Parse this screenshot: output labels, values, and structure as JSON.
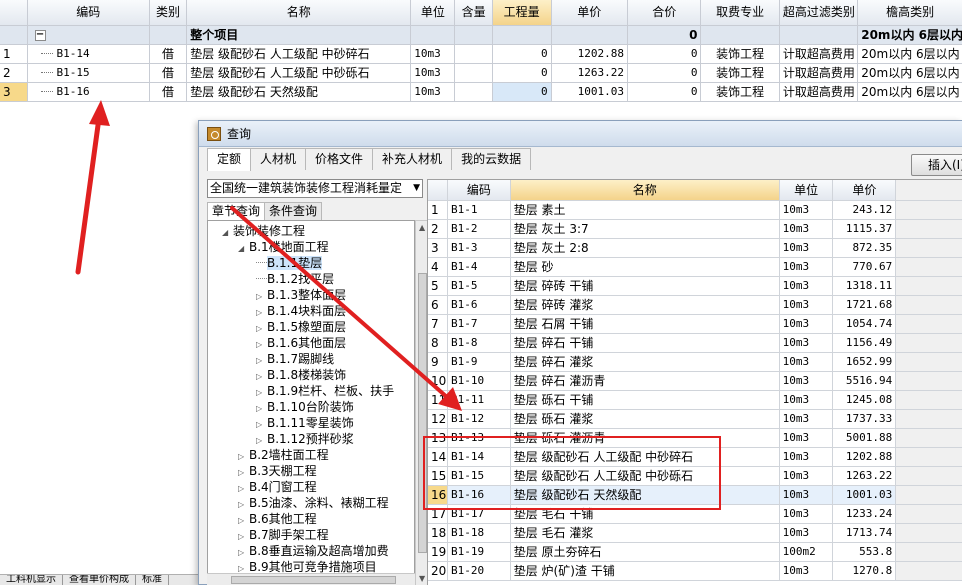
{
  "main_grid": {
    "headers": [
      "编码",
      "类别",
      "名称",
      "单位",
      "含量",
      "工程量",
      "单价",
      "合价",
      "取费专业",
      "超高过滤类别",
      "檐高类别"
    ],
    "group_row": {
      "toggle": "−",
      "name": "整个项目",
      "total": "0",
      "height_class": "20m以内 6层以内"
    },
    "rows": [
      {
        "idx": "1",
        "code": "B1-14",
        "cat": "借",
        "name": "垫层 级配砂石 人工级配 中砂碎石",
        "unit": "10m3",
        "qty": "",
        "amount": "0",
        "price": "1202.88",
        "total": "0",
        "fee": "装饰工程",
        "over": "计取超高费用",
        "height": "20m以内 6层以内"
      },
      {
        "idx": "2",
        "code": "B1-15",
        "cat": "借",
        "name": "垫层 级配砂石 人工级配 中砂砾石",
        "unit": "10m3",
        "qty": "",
        "amount": "0",
        "price": "1263.22",
        "total": "0",
        "fee": "装饰工程",
        "over": "计取超高费用",
        "height": "20m以内 6层以内"
      },
      {
        "idx": "3",
        "code": "B1-16",
        "cat": "借",
        "name": "垫层 级配砂石 天然级配",
        "unit": "10m3",
        "qty": "",
        "amount": "0",
        "price": "1001.03",
        "total": "0",
        "fee": "装饰工程",
        "over": "计取超高费用",
        "height": "20m以内 6层以内"
      }
    ]
  },
  "dialog": {
    "title": "查询",
    "tabs": [
      "定额",
      "人材机",
      "价格文件",
      "补充人材机",
      "我的云数据"
    ],
    "insert_button": "插入(I)",
    "quota_select": "全国统一建筑装饰装修工程消耗量定",
    "sub_tabs": [
      "章节查询",
      "条件查询"
    ],
    "tree": [
      {
        "label": "装饰装修工程",
        "toggle": "◢",
        "level": 0
      },
      {
        "label": "B.1楼地面工程",
        "toggle": "◢",
        "level": 1
      },
      {
        "label": "B.1.1垫层",
        "toggle": "",
        "level": 2,
        "selected": true
      },
      {
        "label": "B.1.2找平层",
        "toggle": "",
        "level": 2
      },
      {
        "label": "B.1.3整体面层",
        "toggle": "▷",
        "level": 2
      },
      {
        "label": "B.1.4块料面层",
        "toggle": "▷",
        "level": 2
      },
      {
        "label": "B.1.5橡塑面层",
        "toggle": "▷",
        "level": 2
      },
      {
        "label": "B.1.6其他面层",
        "toggle": "▷",
        "level": 2
      },
      {
        "label": "B.1.7踢脚线",
        "toggle": "▷",
        "level": 2
      },
      {
        "label": "B.1.8楼梯装饰",
        "toggle": "▷",
        "level": 2
      },
      {
        "label": "B.1.9栏杆、栏板、扶手",
        "toggle": "▷",
        "level": 2
      },
      {
        "label": "B.1.10台阶装饰",
        "toggle": "▷",
        "level": 2
      },
      {
        "label": "B.1.11零星装饰",
        "toggle": "▷",
        "level": 2
      },
      {
        "label": "B.1.12预拌砂浆",
        "toggle": "▷",
        "level": 2
      },
      {
        "label": "B.2墙柱面工程",
        "toggle": "▷",
        "level": 1
      },
      {
        "label": "B.3天棚工程",
        "toggle": "▷",
        "level": 1
      },
      {
        "label": "B.4门窗工程",
        "toggle": "▷",
        "level": 1
      },
      {
        "label": "B.5油漆、涂料、裱糊工程",
        "toggle": "▷",
        "level": 1
      },
      {
        "label": "B.6其他工程",
        "toggle": "▷",
        "level": 1
      },
      {
        "label": "B.7脚手架工程",
        "toggle": "▷",
        "level": 1
      },
      {
        "label": "B.8垂直运输及超高增加费",
        "toggle": "▷",
        "level": 1
      },
      {
        "label": "B.9其他可竞争措施项目",
        "toggle": "▷",
        "level": 1
      }
    ],
    "list_headers": [
      "编码",
      "名称",
      "单位",
      "单价"
    ],
    "list": [
      {
        "idx": "1",
        "code": "B1-1",
        "name": "垫层 素土",
        "unit": "10m3",
        "price": "243.12"
      },
      {
        "idx": "2",
        "code": "B1-2",
        "name": "垫层 灰土 3:7",
        "unit": "10m3",
        "price": "1115.37"
      },
      {
        "idx": "3",
        "code": "B1-3",
        "name": "垫层 灰土 2:8",
        "unit": "10m3",
        "price": "872.35"
      },
      {
        "idx": "4",
        "code": "B1-4",
        "name": "垫层 砂",
        "unit": "10m3",
        "price": "770.67"
      },
      {
        "idx": "5",
        "code": "B1-5",
        "name": "垫层 碎砖 干铺",
        "unit": "10m3",
        "price": "1318.11"
      },
      {
        "idx": "6",
        "code": "B1-6",
        "name": "垫层 碎砖 灌浆",
        "unit": "10m3",
        "price": "1721.68"
      },
      {
        "idx": "7",
        "code": "B1-7",
        "name": "垫层 石屑 干铺",
        "unit": "10m3",
        "price": "1054.74"
      },
      {
        "idx": "8",
        "code": "B1-8",
        "name": "垫层 碎石 干铺",
        "unit": "10m3",
        "price": "1156.49"
      },
      {
        "idx": "9",
        "code": "B1-9",
        "name": "垫层 碎石 灌浆",
        "unit": "10m3",
        "price": "1652.99"
      },
      {
        "idx": "10",
        "code": "B1-10",
        "name": "垫层 碎石 灌沥青",
        "unit": "10m3",
        "price": "5516.94"
      },
      {
        "idx": "11",
        "code": "B1-11",
        "name": "垫层 砾石 干铺",
        "unit": "10m3",
        "price": "1245.08"
      },
      {
        "idx": "12",
        "code": "B1-12",
        "name": "垫层 砾石 灌浆",
        "unit": "10m3",
        "price": "1737.33"
      },
      {
        "idx": "13",
        "code": "B1-13",
        "name": "垫层 砾石 灌沥青",
        "unit": "10m3",
        "price": "5001.88"
      },
      {
        "idx": "14",
        "code": "B1-14",
        "name": "垫层 级配砂石 人工级配 中砂碎石",
        "unit": "10m3",
        "price": "1202.88"
      },
      {
        "idx": "15",
        "code": "B1-15",
        "name": "垫层 级配砂石 人工级配 中砂砾石",
        "unit": "10m3",
        "price": "1263.22"
      },
      {
        "idx": "16",
        "code": "B1-16",
        "name": "垫层 级配砂石 天然级配",
        "unit": "10m3",
        "price": "1001.03",
        "selected": true
      },
      {
        "idx": "17",
        "code": "B1-17",
        "name": "垫层 毛石 干铺",
        "unit": "10m3",
        "price": "1233.24"
      },
      {
        "idx": "18",
        "code": "B1-18",
        "name": "垫层 毛石 灌浆",
        "unit": "10m3",
        "price": "1713.74"
      },
      {
        "idx": "19",
        "code": "B1-19",
        "name": "垫层 原土夯碎石",
        "unit": "100m2",
        "price": "553.8"
      },
      {
        "idx": "20",
        "code": "B1-20",
        "name": "垫层 炉(矿)渣 干铺",
        "unit": "10m3",
        "price": "1270.8"
      }
    ]
  },
  "bottom_tabs": [
    "工料机显示",
    "查看单价构成",
    "标准"
  ],
  "colors": {
    "annotation_red": "#e02020",
    "header_highlight": "#f4d38a",
    "selection": "#cde4fb"
  }
}
